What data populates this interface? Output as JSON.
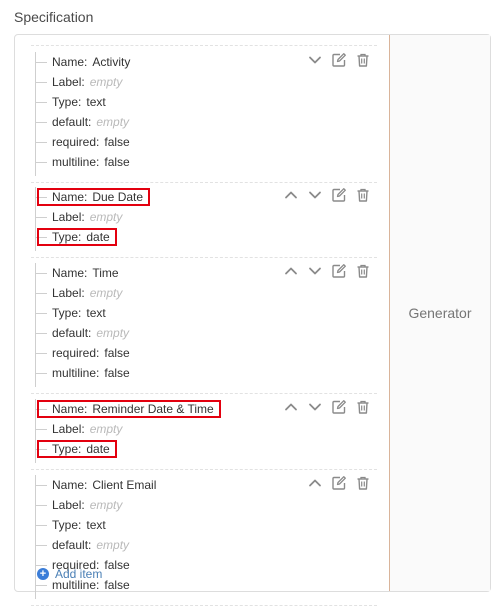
{
  "header": {
    "title": "Specification"
  },
  "generator_label": "Generator",
  "items": [
    {
      "fields": [
        {
          "key": "Name:",
          "value": "Activity",
          "empty": false
        },
        {
          "key": "Label:",
          "value": "empty",
          "empty": true
        },
        {
          "key": "Type:",
          "value": "text",
          "empty": false
        },
        {
          "key": "default:",
          "value": "empty",
          "empty": true
        },
        {
          "key": "required:",
          "value": "false",
          "empty": false
        },
        {
          "key": "multiline:",
          "value": "false",
          "empty": false
        }
      ],
      "actions": [
        "move-down",
        "edit",
        "delete"
      ]
    },
    {
      "fields": [
        {
          "key": "Name:",
          "value": "Due Date",
          "empty": false
        },
        {
          "key": "Label:",
          "value": "empty",
          "empty": true
        },
        {
          "key": "Type:",
          "value": "date",
          "empty": false
        }
      ],
      "actions": [
        "move-up",
        "move-down",
        "edit",
        "delete"
      ],
      "highlighted_fields": [
        0,
        2
      ]
    },
    {
      "fields": [
        {
          "key": "Name:",
          "value": "Time",
          "empty": false
        },
        {
          "key": "Label:",
          "value": "empty",
          "empty": true
        },
        {
          "key": "Type:",
          "value": "text",
          "empty": false
        },
        {
          "key": "default:",
          "value": "empty",
          "empty": true
        },
        {
          "key": "required:",
          "value": "false",
          "empty": false
        },
        {
          "key": "multiline:",
          "value": "false",
          "empty": false
        }
      ],
      "actions": [
        "move-up",
        "move-down",
        "edit",
        "delete"
      ]
    },
    {
      "fields": [
        {
          "key": "Name:",
          "value": "Reminder Date & Time",
          "empty": false
        },
        {
          "key": "Label:",
          "value": "empty",
          "empty": true
        },
        {
          "key": "Type:",
          "value": "date",
          "empty": false
        }
      ],
      "actions": [
        "move-up",
        "move-down",
        "edit",
        "delete"
      ],
      "highlighted_fields": [
        0,
        2
      ]
    },
    {
      "fields": [
        {
          "key": "Name:",
          "value": "Client Email",
          "empty": false
        },
        {
          "key": "Label:",
          "value": "empty",
          "empty": true
        },
        {
          "key": "Type:",
          "value": "text",
          "empty": false
        },
        {
          "key": "default:",
          "value": "empty",
          "empty": true
        },
        {
          "key": "required:",
          "value": "false",
          "empty": false
        },
        {
          "key": "multiline:",
          "value": "false",
          "empty": false
        }
      ],
      "actions": [
        "move-up",
        "edit",
        "delete"
      ]
    }
  ],
  "add_item_label": "Add item",
  "colors": {
    "highlight": "#e3000f",
    "accent": "#3b7dd8",
    "placeholder": "#b9b9b9"
  }
}
